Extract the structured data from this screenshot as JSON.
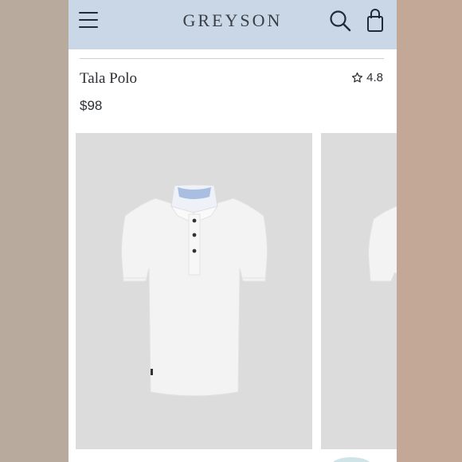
{
  "header": {
    "brand": "GREYSON",
    "menu_icon": "hamburger-menu-icon",
    "search_icon": "search-icon",
    "bag_icon": "shopping-bag-icon",
    "background_color": "#c9d7e6"
  },
  "product": {
    "name": "Tala Polo",
    "rating": "4.8",
    "rating_icon": "star-outline-icon",
    "price": "$98"
  },
  "gallery": {
    "tile_color": "#dcdcdc",
    "images": [
      "white-polo-front-image",
      "white-polo-side-image"
    ]
  }
}
